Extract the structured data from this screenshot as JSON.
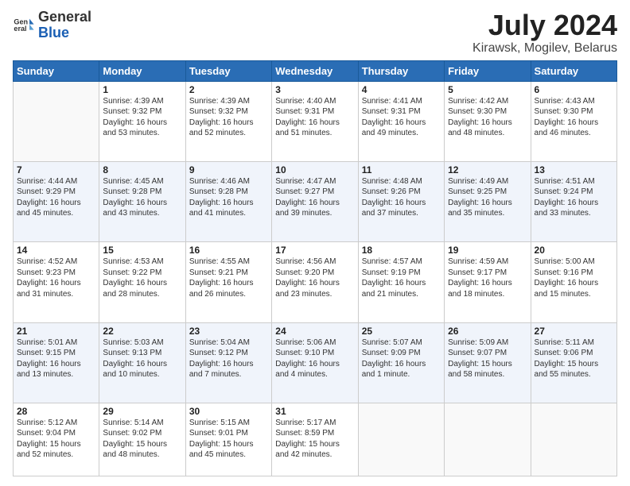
{
  "header": {
    "logo_general": "General",
    "logo_blue": "Blue",
    "title": "July 2024",
    "location": "Kirawsk, Mogilev, Belarus"
  },
  "weekdays": [
    "Sunday",
    "Monday",
    "Tuesday",
    "Wednesday",
    "Thursday",
    "Friday",
    "Saturday"
  ],
  "weeks": [
    [
      {
        "day": "",
        "info": ""
      },
      {
        "day": "1",
        "info": "Sunrise: 4:39 AM\nSunset: 9:32 PM\nDaylight: 16 hours\nand 53 minutes."
      },
      {
        "day": "2",
        "info": "Sunrise: 4:39 AM\nSunset: 9:32 PM\nDaylight: 16 hours\nand 52 minutes."
      },
      {
        "day": "3",
        "info": "Sunrise: 4:40 AM\nSunset: 9:31 PM\nDaylight: 16 hours\nand 51 minutes."
      },
      {
        "day": "4",
        "info": "Sunrise: 4:41 AM\nSunset: 9:31 PM\nDaylight: 16 hours\nand 49 minutes."
      },
      {
        "day": "5",
        "info": "Sunrise: 4:42 AM\nSunset: 9:30 PM\nDaylight: 16 hours\nand 48 minutes."
      },
      {
        "day": "6",
        "info": "Sunrise: 4:43 AM\nSunset: 9:30 PM\nDaylight: 16 hours\nand 46 minutes."
      }
    ],
    [
      {
        "day": "7",
        "info": "Sunrise: 4:44 AM\nSunset: 9:29 PM\nDaylight: 16 hours\nand 45 minutes."
      },
      {
        "day": "8",
        "info": "Sunrise: 4:45 AM\nSunset: 9:28 PM\nDaylight: 16 hours\nand 43 minutes."
      },
      {
        "day": "9",
        "info": "Sunrise: 4:46 AM\nSunset: 9:28 PM\nDaylight: 16 hours\nand 41 minutes."
      },
      {
        "day": "10",
        "info": "Sunrise: 4:47 AM\nSunset: 9:27 PM\nDaylight: 16 hours\nand 39 minutes."
      },
      {
        "day": "11",
        "info": "Sunrise: 4:48 AM\nSunset: 9:26 PM\nDaylight: 16 hours\nand 37 minutes."
      },
      {
        "day": "12",
        "info": "Sunrise: 4:49 AM\nSunset: 9:25 PM\nDaylight: 16 hours\nand 35 minutes."
      },
      {
        "day": "13",
        "info": "Sunrise: 4:51 AM\nSunset: 9:24 PM\nDaylight: 16 hours\nand 33 minutes."
      }
    ],
    [
      {
        "day": "14",
        "info": "Sunrise: 4:52 AM\nSunset: 9:23 PM\nDaylight: 16 hours\nand 31 minutes."
      },
      {
        "day": "15",
        "info": "Sunrise: 4:53 AM\nSunset: 9:22 PM\nDaylight: 16 hours\nand 28 minutes."
      },
      {
        "day": "16",
        "info": "Sunrise: 4:55 AM\nSunset: 9:21 PM\nDaylight: 16 hours\nand 26 minutes."
      },
      {
        "day": "17",
        "info": "Sunrise: 4:56 AM\nSunset: 9:20 PM\nDaylight: 16 hours\nand 23 minutes."
      },
      {
        "day": "18",
        "info": "Sunrise: 4:57 AM\nSunset: 9:19 PM\nDaylight: 16 hours\nand 21 minutes."
      },
      {
        "day": "19",
        "info": "Sunrise: 4:59 AM\nSunset: 9:17 PM\nDaylight: 16 hours\nand 18 minutes."
      },
      {
        "day": "20",
        "info": "Sunrise: 5:00 AM\nSunset: 9:16 PM\nDaylight: 16 hours\nand 15 minutes."
      }
    ],
    [
      {
        "day": "21",
        "info": "Sunrise: 5:01 AM\nSunset: 9:15 PM\nDaylight: 16 hours\nand 13 minutes."
      },
      {
        "day": "22",
        "info": "Sunrise: 5:03 AM\nSunset: 9:13 PM\nDaylight: 16 hours\nand 10 minutes."
      },
      {
        "day": "23",
        "info": "Sunrise: 5:04 AM\nSunset: 9:12 PM\nDaylight: 16 hours\nand 7 minutes."
      },
      {
        "day": "24",
        "info": "Sunrise: 5:06 AM\nSunset: 9:10 PM\nDaylight: 16 hours\nand 4 minutes."
      },
      {
        "day": "25",
        "info": "Sunrise: 5:07 AM\nSunset: 9:09 PM\nDaylight: 16 hours\nand 1 minute."
      },
      {
        "day": "26",
        "info": "Sunrise: 5:09 AM\nSunset: 9:07 PM\nDaylight: 15 hours\nand 58 minutes."
      },
      {
        "day": "27",
        "info": "Sunrise: 5:11 AM\nSunset: 9:06 PM\nDaylight: 15 hours\nand 55 minutes."
      }
    ],
    [
      {
        "day": "28",
        "info": "Sunrise: 5:12 AM\nSunset: 9:04 PM\nDaylight: 15 hours\nand 52 minutes."
      },
      {
        "day": "29",
        "info": "Sunrise: 5:14 AM\nSunset: 9:02 PM\nDaylight: 15 hours\nand 48 minutes."
      },
      {
        "day": "30",
        "info": "Sunrise: 5:15 AM\nSunset: 9:01 PM\nDaylight: 15 hours\nand 45 minutes."
      },
      {
        "day": "31",
        "info": "Sunrise: 5:17 AM\nSunset: 8:59 PM\nDaylight: 15 hours\nand 42 minutes."
      },
      {
        "day": "",
        "info": ""
      },
      {
        "day": "",
        "info": ""
      },
      {
        "day": "",
        "info": ""
      }
    ]
  ]
}
